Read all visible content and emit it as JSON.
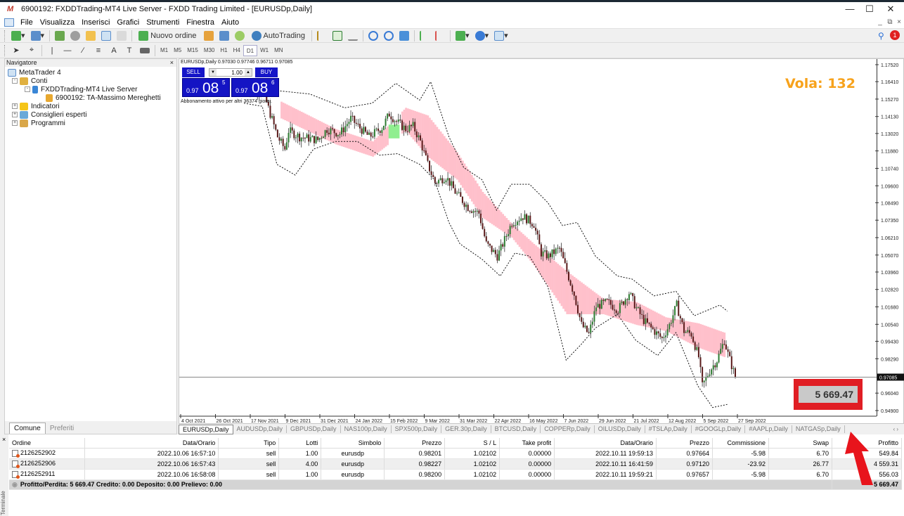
{
  "window": {
    "title": "6900192: FXDDTrading-MT4 Live Server - FXDD Trading Limited - [EURUSDp,Daily]",
    "controls": [
      "minimize",
      "maximize",
      "close"
    ]
  },
  "menu": [
    "File",
    "Visualizza",
    "Inserisci",
    "Grafici",
    "Strumenti",
    "Finestra",
    "Aiuto"
  ],
  "toolbar": {
    "new_order": "Nuovo ordine",
    "autotrading": "AutoTrading",
    "timeframes": [
      "M1",
      "M5",
      "M15",
      "M30",
      "H1",
      "H4",
      "D1",
      "W1",
      "MN"
    ],
    "active_timeframe": "D1",
    "notification_count": "1"
  },
  "navigator": {
    "title": "Navigatore",
    "tree": [
      {
        "label": "MetaTrader 4",
        "level": 0,
        "icon": "terminal-icon"
      },
      {
        "label": "Conti",
        "level": 1,
        "icon": "accounts-icon",
        "expander": "-"
      },
      {
        "label": "FXDDTrading-MT4 Live Server",
        "level": 2,
        "icon": "server-icon",
        "expander": "-"
      },
      {
        "label": "6900192: TA-Massimo Mereghetti",
        "level": 3,
        "icon": "user-icon"
      },
      {
        "label": "Indicatori",
        "level": 1,
        "icon": "indicator-icon",
        "expander": "+"
      },
      {
        "label": "Consiglieri esperti",
        "level": 1,
        "icon": "expert-icon",
        "expander": "+"
      },
      {
        "label": "Programmi",
        "level": 1,
        "icon": "script-icon",
        "expander": "+"
      }
    ],
    "tabs": [
      "Comune",
      "Preferiti"
    ],
    "active_tab": "Comune"
  },
  "chart": {
    "ohlc_header": "EURUSDp,Daily  0.97030 0.97746 0.96711 0.97085",
    "trade_panel": {
      "sell_label": "SELL",
      "buy_label": "BUY",
      "lot": "1.00",
      "sell_prefix": "0.97",
      "sell_big": "08",
      "sell_sup": "5",
      "buy_prefix": "0.97",
      "buy_big": "08",
      "buy_sup": "6"
    },
    "subscription_note": "Abbonamento attivo per altri 36374 giorni.",
    "vola_label": "Vola: 132",
    "profit_overlay": "5 669.47",
    "current_price": "0.97085",
    "colors": {
      "band": "#ffc0cb",
      "green_zone": "#90ee90",
      "vola": "#f7a21b",
      "bull": "#2e7d32",
      "bear": "#5a1a1a"
    }
  },
  "chart_data": {
    "type": "candlestick",
    "title": "EURUSDp,Daily",
    "xlabel": "",
    "ylabel": "",
    "x_ticks": [
      "4 Oct 2021",
      "26 Oct 2021",
      "17 Nov 2021",
      "9 Dec 2021",
      "31 Dec 2021",
      "24 Jan 2022",
      "15 Feb 2022",
      "9 Mar 2022",
      "31 Mar 2022",
      "22 Apr 2022",
      "16 May 2022",
      "7 Jun 2022",
      "29 Jun 2022",
      "21 Jul 2022",
      "12 Aug 2022",
      "5 Sep 2022",
      "27 Sep 2022"
    ],
    "y_ticks": [
      "1.17520",
      "1.16410",
      "1.15270",
      "1.14130",
      "1.13020",
      "1.11880",
      "1.10740",
      "1.09600",
      "1.08490",
      "1.07350",
      "1.06210",
      "1.05070",
      "1.03960",
      "1.02820",
      "1.01680",
      "1.00540",
      "0.99430",
      "0.98290",
      "0.97085",
      "0.96040",
      "0.94900"
    ],
    "ylim": [
      0.949,
      1.1752
    ],
    "close_path": [
      [
        0,
        1.16
      ],
      [
        10,
        1.158
      ],
      [
        18,
        1.128
      ],
      [
        22,
        1.12
      ],
      [
        24,
        1.132
      ],
      [
        30,
        1.128
      ],
      [
        40,
        1.126
      ],
      [
        45,
        1.133
      ],
      [
        52,
        1.13
      ],
      [
        58,
        1.14
      ],
      [
        62,
        1.135
      ],
      [
        68,
        1.128
      ],
      [
        75,
        1.134
      ],
      [
        79,
        1.143
      ],
      [
        83,
        1.138
      ],
      [
        88,
        1.133
      ],
      [
        92,
        1.135
      ],
      [
        96,
        1.125
      ],
      [
        100,
        1.11
      ],
      [
        104,
        1.098
      ],
      [
        110,
        1.102
      ],
      [
        115,
        1.092
      ],
      [
        122,
        1.082
      ],
      [
        128,
        1.078
      ],
      [
        132,
        1.058
      ],
      [
        138,
        1.05
      ],
      [
        140,
        1.055
      ],
      [
        146,
        1.072
      ],
      [
        152,
        1.076
      ],
      [
        158,
        1.071
      ],
      [
        162,
        1.052
      ],
      [
        166,
        1.05
      ],
      [
        172,
        1.055
      ],
      [
        176,
        1.04
      ],
      [
        180,
        1.025
      ],
      [
        184,
        1.005
      ],
      [
        188,
        0.999
      ],
      [
        192,
        1.017
      ],
      [
        198,
        1.02
      ],
      [
        204,
        1.015
      ],
      [
        210,
        1.026
      ],
      [
        214,
        1.016
      ],
      [
        218,
        1.008
      ],
      [
        222,
        1.003
      ],
      [
        228,
        0.996
      ],
      [
        232,
        1.005
      ],
      [
        236,
        1.018
      ],
      [
        240,
        1.001
      ],
      [
        244,
        0.999
      ],
      [
        248,
        0.984
      ],
      [
        250,
        0.965
      ],
      [
        254,
        0.975
      ],
      [
        258,
        0.982
      ],
      [
        262,
        0.995
      ],
      [
        264,
        0.986
      ],
      [
        268,
        0.971
      ]
    ],
    "upper_band": [
      [
        0,
        1.155
      ],
      [
        20,
        1.158
      ],
      [
        36,
        1.156
      ],
      [
        55,
        1.147
      ],
      [
        70,
        1.15
      ],
      [
        83,
        1.163
      ],
      [
        96,
        1.152
      ],
      [
        102,
        1.164
      ],
      [
        112,
        1.128
      ],
      [
        120,
        1.108
      ],
      [
        130,
        1.1
      ],
      [
        138,
        1.08
      ],
      [
        146,
        1.097
      ],
      [
        156,
        1.097
      ],
      [
        166,
        1.085
      ],
      [
        174,
        1.07
      ],
      [
        182,
        1.072
      ],
      [
        192,
        1.05
      ],
      [
        204,
        1.037
      ],
      [
        212,
        1.035
      ],
      [
        224,
        1.024
      ],
      [
        236,
        1.027
      ],
      [
        246,
        1.011
      ],
      [
        260,
        1.018
      ],
      [
        264,
        1.014
      ]
    ],
    "lower_band": [
      [
        0,
        1.15
      ],
      [
        10,
        1.148
      ],
      [
        18,
        1.11
      ],
      [
        28,
        1.103
      ],
      [
        38,
        1.12
      ],
      [
        50,
        1.125
      ],
      [
        62,
        1.125
      ],
      [
        74,
        1.116
      ],
      [
        84,
        1.117
      ],
      [
        96,
        1.11
      ],
      [
        104,
        1.1
      ],
      [
        112,
        1.072
      ],
      [
        118,
        1.058
      ],
      [
        130,
        1.048
      ],
      [
        140,
        1.037
      ],
      [
        148,
        1.052
      ],
      [
        156,
        1.05
      ],
      [
        166,
        1.03
      ],
      [
        176,
        0.982
      ],
      [
        184,
        0.992
      ],
      [
        192,
        1.003
      ],
      [
        204,
        1.012
      ],
      [
        214,
        0.995
      ],
      [
        226,
        0.985
      ],
      [
        236,
        1.0
      ],
      [
        248,
        0.965
      ],
      [
        256,
        0.951
      ],
      [
        264,
        0.953
      ]
    ],
    "band_zone": [
      [
        20,
        1.151,
        1.14
      ],
      [
        50,
        1.133,
        1.123
      ],
      [
        70,
        1.125,
        1.115
      ],
      [
        88,
        1.147,
        1.132
      ],
      [
        100,
        1.142,
        1.115
      ],
      [
        116,
        1.118,
        1.1
      ],
      [
        130,
        1.092,
        1.075
      ],
      [
        146,
        1.071,
        1.062
      ],
      [
        158,
        1.058,
        1.044
      ],
      [
        176,
        1.04,
        1.012
      ],
      [
        196,
        1.022,
        1.012
      ],
      [
        214,
        1.02,
        1.005
      ],
      [
        230,
        1.01,
        1.001
      ],
      [
        248,
        1.006,
        0.99
      ],
      [
        262,
        1.0,
        0.984
      ]
    ],
    "green_zone": {
      "x_range": [
        79,
        85
      ],
      "y_range": [
        1.127,
        1.136
      ]
    }
  },
  "symbol_tabs": [
    "EURUSDp,Daily",
    "AUDUSDp,Daily",
    "GBPUSDp,Daily",
    "NAS100p,Daily",
    "SPX500p,Daily",
    "GER.30p,Daily",
    "BTCUSD,Daily",
    "COPPERp,Daily",
    "OILUSDp,Daily",
    "#TSLAp,Daily",
    "#GOOGLp,Daily",
    "#AAPLp,Daily",
    "NATGASp,Daily"
  ],
  "active_symbol_tab": "EURUSDp,Daily",
  "terminal": {
    "columns": [
      "Ordine",
      "Data/Orario",
      "Tipo",
      "Lotti",
      "Simbolo",
      "Prezzo",
      "S / L",
      "Take profit",
      "Data/Orario",
      "Prezzo",
      "Commissione",
      "Swap",
      "Profitto"
    ],
    "rows": [
      [
        "2126252902",
        "2022.10.06 16:57:10",
        "sell",
        "1.00",
        "eurusdp",
        "0.98201",
        "1.02102",
        "0.00000",
        "2022.10.11 19:59:13",
        "0.97664",
        "-5.98",
        "6.70",
        "549.84"
      ],
      [
        "2126252906",
        "2022.10.06 16:57:43",
        "sell",
        "4.00",
        "eurusdp",
        "0.98227",
        "1.02102",
        "0.00000",
        "2022.10.11 16:41:59",
        "0.97120",
        "-23.92",
        "26.77",
        "4 559.31"
      ],
      [
        "2126252911",
        "2022.10.06 16:58:08",
        "sell",
        "1.00",
        "eurusdp",
        "0.98200",
        "1.02102",
        "0.00000",
        "2022.10.11 19:59:21",
        "0.97657",
        "-5.98",
        "6.70",
        "556.03"
      ]
    ],
    "summary": "Profitto/Perdita: 5 669.47  Credito: 0.00  Deposito: 0.00  Prelievo: 0.00",
    "total": "5 669.47",
    "side_label": "Terminale"
  }
}
